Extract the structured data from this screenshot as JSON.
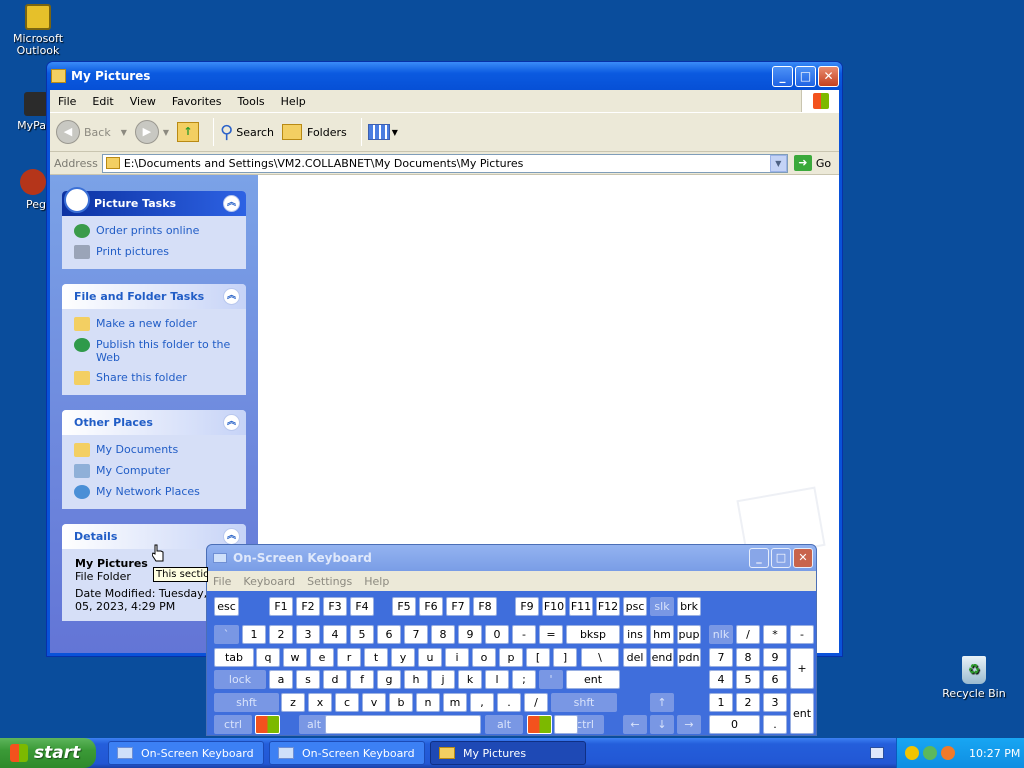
{
  "desktop": {
    "icons": [
      {
        "label": "Microsoft Outlook",
        "icon": "outlook-icon"
      },
      {
        "label": "MyPa",
        "icon": "my-pictures-shortcut-icon"
      },
      {
        "label": "Peg",
        "icon": "pegasus-icon"
      },
      {
        "label": "Recycle Bin",
        "icon": "recycle-bin-icon"
      }
    ]
  },
  "window": {
    "title": "My Pictures",
    "menu": [
      "File",
      "Edit",
      "View",
      "Favorites",
      "Tools",
      "Help"
    ],
    "toolbar": {
      "back": "Back",
      "search": "Search",
      "folders": "Folders"
    },
    "address": {
      "label": "Address",
      "value": "E:\\Documents and Settings\\VM2.COLLABNET\\My Documents\\My Pictures",
      "go": "Go"
    },
    "panels": {
      "picture_tasks": {
        "title": "Picture Tasks",
        "items": [
          "Order prints online",
          "Print pictures"
        ]
      },
      "file_folder_tasks": {
        "title": "File and Folder Tasks",
        "items": [
          "Make a new folder",
          "Publish this folder to the Web",
          "Share this folder"
        ]
      },
      "other_places": {
        "title": "Other Places",
        "items": [
          "My Documents",
          "My Computer",
          "My Network Places"
        ]
      },
      "details": {
        "title": "Details",
        "name": "My Pictures",
        "type": "File Folder",
        "modified": "Date Modified: Tuesday, September 05, 2023, 4:29 PM"
      }
    },
    "tooltip": "This section"
  },
  "osk": {
    "title": "On-Screen Keyboard",
    "menu": [
      "File",
      "Keyboard",
      "Settings",
      "Help"
    ],
    "rows": {
      "r1": [
        "esc",
        "F1",
        "F2",
        "F3",
        "F4",
        "F5",
        "F6",
        "F7",
        "F8",
        "F9",
        "F10",
        "F11",
        "F12",
        "psc",
        "slk",
        "brk"
      ],
      "r2": [
        "`",
        "1",
        "2",
        "3",
        "4",
        "5",
        "6",
        "7",
        "8",
        "9",
        "0",
        "-",
        "=",
        "bksp",
        "ins",
        "hm",
        "pup",
        "nlk",
        "/",
        "*",
        "-"
      ],
      "r3": [
        "tab",
        "q",
        "w",
        "e",
        "r",
        "t",
        "y",
        "u",
        "i",
        "o",
        "p",
        "[",
        "]",
        "\\",
        "del",
        "end",
        "pdn",
        "7",
        "8",
        "9",
        "+"
      ],
      "r4": [
        "lock",
        "a",
        "s",
        "d",
        "f",
        "g",
        "h",
        "j",
        "k",
        "l",
        ";",
        "'",
        "ent",
        "4",
        "5",
        "6"
      ],
      "r5": [
        "shft",
        "z",
        "x",
        "c",
        "v",
        "b",
        "n",
        "m",
        ",",
        ".",
        "/",
        "shft",
        "↑",
        "1",
        "2",
        "3",
        "ent"
      ],
      "r6": [
        "ctrl",
        "alt",
        "alt",
        "ctrl",
        "←",
        "↓",
        "→",
        "0",
        "."
      ]
    }
  },
  "taskbar": {
    "start": "start",
    "tasks": [
      "On-Screen Keyboard",
      "On-Screen Keyboard",
      "My Pictures"
    ],
    "clock": "10:27 PM"
  }
}
